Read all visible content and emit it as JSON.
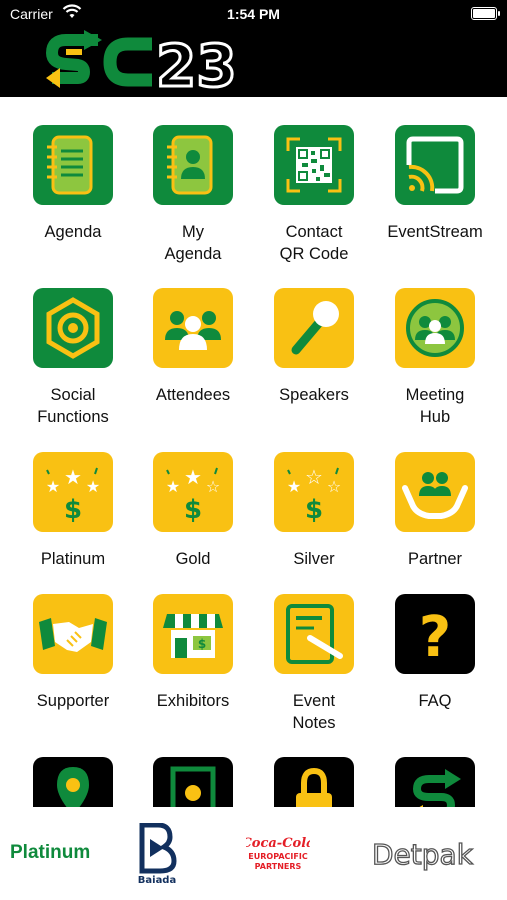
{
  "status_bar": {
    "carrier": "Carrier",
    "time": "1:54 PM"
  },
  "header": {
    "logo_text": "SC23"
  },
  "tiles": [
    {
      "label": "Agenda",
      "icon": "notebook-icon"
    },
    {
      "label": "My\nAgenda",
      "icon": "contact-book-icon"
    },
    {
      "label": "Contact\nQR Code",
      "icon": "qr-code-icon"
    },
    {
      "label": "EventStream",
      "icon": "cast-screen-icon"
    },
    {
      "label": "Social\nFunctions",
      "icon": "hexagon-nut-icon"
    },
    {
      "label": "Attendees",
      "icon": "people-group-icon"
    },
    {
      "label": "Speakers",
      "icon": "microphone-icon"
    },
    {
      "label": "Meeting\nHub",
      "icon": "meeting-group-icon"
    },
    {
      "label": "Platinum",
      "icon": "stars-dollar-icon"
    },
    {
      "label": "Gold",
      "icon": "stars-dollar-icon"
    },
    {
      "label": "Silver",
      "icon": "stars-dollar-icon"
    },
    {
      "label": "Partner",
      "icon": "hands-people-icon"
    },
    {
      "label": "Supporter",
      "icon": "handshake-icon"
    },
    {
      "label": "Exhibitors",
      "icon": "storefront-icon"
    },
    {
      "label": "Event\nNotes",
      "icon": "note-pen-icon"
    },
    {
      "label": "FAQ",
      "icon": "question-mark-icon"
    },
    {
      "label": "",
      "icon": "map-pin-icon"
    },
    {
      "label": "",
      "icon": "door-icon"
    },
    {
      "label": "",
      "icon": "lock-icon"
    },
    {
      "label": "",
      "icon": "sc-logo-icon"
    }
  ],
  "sponsors": {
    "tier_label": "Platinum",
    "logos": [
      {
        "name": "Baiada",
        "text": "Baiada"
      },
      {
        "name": "Coca-Cola Europacific Partners",
        "line1": "Coca-Cola",
        "line2": "EUROPACIFIC",
        "line3": "PARTNERS"
      },
      {
        "name": "Detpak",
        "text": "Detpak"
      }
    ]
  },
  "colors": {
    "green": "#0f8a3c",
    "yellow": "#f9c113",
    "black": "#000000"
  }
}
